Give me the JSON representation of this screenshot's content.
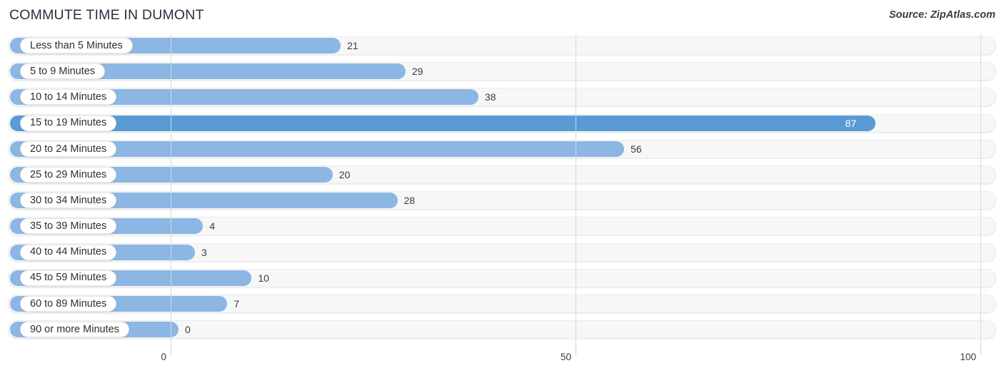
{
  "header": {
    "title": "COMMUTE TIME IN DUMONT",
    "source": "Source: ZipAtlas.com"
  },
  "colors": {
    "bar": "#8cb6e3",
    "bar_max": "#5b9bd5",
    "track": "#f7f7f7",
    "gridline": "#d8d8d8",
    "title": "#2b2f40"
  },
  "axis": {
    "ticks": [
      {
        "value": 0,
        "label": "0"
      },
      {
        "value": 50,
        "label": "50"
      },
      {
        "value": 100,
        "label": "100"
      }
    ],
    "min": 0,
    "max": 100
  },
  "chart_data": {
    "type": "bar",
    "orientation": "horizontal",
    "title": "COMMUTE TIME IN DUMONT",
    "subtitle": "",
    "xlabel": "",
    "ylabel": "",
    "xlim": [
      0,
      100
    ],
    "grid": true,
    "legend": "none",
    "source": "Source: ZipAtlas.com",
    "highlight_category": "15 to 19 Minutes",
    "categories": [
      "Less than 5 Minutes",
      "5 to 9 Minutes",
      "10 to 14 Minutes",
      "15 to 19 Minutes",
      "20 to 24 Minutes",
      "25 to 29 Minutes",
      "30 to 34 Minutes",
      "35 to 39 Minutes",
      "40 to 44 Minutes",
      "45 to 59 Minutes",
      "60 to 89 Minutes",
      "90 or more Minutes"
    ],
    "values": [
      21,
      29,
      38,
      87,
      56,
      20,
      28,
      4,
      3,
      10,
      7,
      0
    ],
    "rows": [
      {
        "label": "Less than 5 Minutes",
        "value": 21,
        "value_label": "21",
        "highlight": false
      },
      {
        "label": "5 to 9 Minutes",
        "value": 29,
        "value_label": "29",
        "highlight": false
      },
      {
        "label": "10 to 14 Minutes",
        "value": 38,
        "value_label": "38",
        "highlight": false
      },
      {
        "label": "15 to 19 Minutes",
        "value": 87,
        "value_label": "87",
        "highlight": true
      },
      {
        "label": "20 to 24 Minutes",
        "value": 56,
        "value_label": "56",
        "highlight": false
      },
      {
        "label": "25 to 29 Minutes",
        "value": 20,
        "value_label": "20",
        "highlight": false
      },
      {
        "label": "30 to 34 Minutes",
        "value": 28,
        "value_label": "28",
        "highlight": false
      },
      {
        "label": "35 to 39 Minutes",
        "value": 4,
        "value_label": "4",
        "highlight": false
      },
      {
        "label": "40 to 44 Minutes",
        "value": 3,
        "value_label": "3",
        "highlight": false
      },
      {
        "label": "45 to 59 Minutes",
        "value": 10,
        "value_label": "10",
        "highlight": false
      },
      {
        "label": "60 to 89 Minutes",
        "value": 7,
        "value_label": "7",
        "highlight": false
      },
      {
        "label": "90 or more Minutes",
        "value": 0,
        "value_label": "0",
        "highlight": false
      }
    ]
  }
}
